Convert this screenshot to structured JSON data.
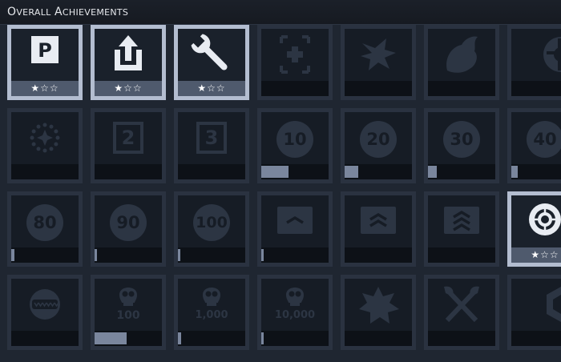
{
  "header": {
    "title": "Overall Achievements"
  },
  "colors": {
    "background": "#1f2631",
    "tile_frame": "#2a3240",
    "tile_unlocked_frame": "#b3bdd0",
    "icon_locked": "#2c3543",
    "progress_fill": "#7a869d"
  },
  "achievements": [
    {
      "icon": "parking-icon",
      "unlocked": true,
      "stars": "★☆☆"
    },
    {
      "icon": "share-upload-icon",
      "unlocked": true,
      "stars": "★☆☆"
    },
    {
      "icon": "wrench-icon",
      "unlocked": true,
      "stars": "★☆☆"
    },
    {
      "icon": "medkit-icon",
      "unlocked": false,
      "progress": 0
    },
    {
      "icon": "splatter-bird-icon",
      "unlocked": false,
      "progress": 0
    },
    {
      "icon": "fire-beast-icon",
      "unlocked": false,
      "progress": 0
    },
    {
      "icon": "lifebuoy-icon",
      "unlocked": false,
      "progress": 0
    },
    {
      "icon": "sparkle-burst-icon",
      "unlocked": false,
      "progress": 0
    },
    {
      "icon": "square-number-icon",
      "label": "2",
      "unlocked": false,
      "progress": 0
    },
    {
      "icon": "square-number-icon",
      "label": "3",
      "unlocked": false,
      "progress": 0
    },
    {
      "icon": "circle-number-icon",
      "label": "10",
      "unlocked": false,
      "progress": 0.4
    },
    {
      "icon": "circle-number-icon",
      "label": "20",
      "unlocked": false,
      "progress": 0.2
    },
    {
      "icon": "circle-number-icon",
      "label": "30",
      "unlocked": false,
      "progress": 0.13
    },
    {
      "icon": "circle-number-icon",
      "label": "40",
      "unlocked": false,
      "progress": 0.1
    },
    {
      "icon": "circle-number-icon",
      "label": "80",
      "unlocked": false,
      "progress": 0.05
    },
    {
      "icon": "circle-number-icon",
      "label": "90",
      "unlocked": false,
      "progress": 0.04
    },
    {
      "icon": "circle-number-icon",
      "label": "100",
      "unlocked": false,
      "progress": 0.04
    },
    {
      "icon": "rank-chevron-1-icon",
      "unlocked": false,
      "progress": 0.02
    },
    {
      "icon": "rank-chevron-2-icon",
      "unlocked": false,
      "progress": 0
    },
    {
      "icon": "rank-chevron-3-icon",
      "unlocked": false,
      "progress": 0
    },
    {
      "icon": "crosshair-icon",
      "unlocked": true,
      "stars": "★☆☆"
    },
    {
      "icon": "sawblade-icon",
      "unlocked": false,
      "progress": 0
    },
    {
      "icon": "skull-count-icon",
      "label": "100",
      "unlocked": false,
      "progress": 0.48
    },
    {
      "icon": "skull-count-icon",
      "label": "1,000",
      "unlocked": false,
      "progress": 0.05
    },
    {
      "icon": "skull-count-icon",
      "label": "10,000",
      "unlocked": false,
      "progress": 0.02
    },
    {
      "icon": "splatter-cross-icon",
      "unlocked": false,
      "progress": 0
    },
    {
      "icon": "crossed-axes-icon",
      "unlocked": false,
      "progress": 0
    },
    {
      "icon": "cube-badge-icon",
      "unlocked": false,
      "progress": 0
    }
  ]
}
